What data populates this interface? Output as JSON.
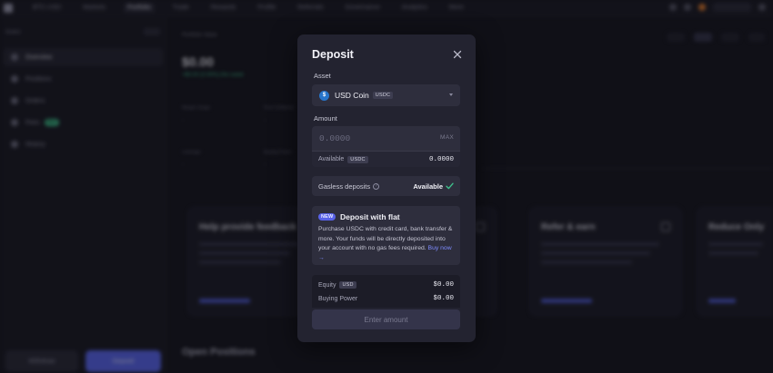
{
  "background": {
    "nav": [
      "BTC-USD",
      "Markets",
      "Portfolio",
      "Trade",
      "Rewards",
      "Profile",
      "Referrals",
      "Governance",
      "Analytics",
      "More"
    ],
    "sidebar": {
      "header": "Wallet",
      "items": [
        {
          "label": "Overview",
          "icon": "grid-icon"
        },
        {
          "label": "Positions",
          "icon": "position-icon"
        },
        {
          "label": "Orders",
          "icon": "orders-icon"
        },
        {
          "label": "Fees",
          "icon": "fees-icon",
          "badge": "New"
        },
        {
          "label": "History",
          "icon": "history-icon"
        }
      ],
      "withdraw_label": "Withdraw",
      "deposit_label": "Deposit"
    },
    "main": {
      "header": "Portfolio Value",
      "balance": "$0.00",
      "change": "+$0.00 (0.00%) this week",
      "stats": [
        "Margin Usage",
        "Free Collateral",
        "Leverage",
        "Buying Power"
      ],
      "cards": [
        {
          "title": "Help provide feedback"
        },
        {
          "title": "Refer & earn"
        },
        {
          "title": "Reduce Only"
        }
      ],
      "open_positions": "Open Positions"
    }
  },
  "modal": {
    "title": "Deposit",
    "close_icon": "close-icon",
    "asset_label": "Asset",
    "asset": {
      "name": "USD Coin",
      "ticker": "USDC",
      "icon": "usdc-coin-icon",
      "icon_letter": "$"
    },
    "amount_label": "Amount",
    "amount_placeholder": "0.0000",
    "max_label": "MAX",
    "available_label": "Available",
    "available_ticker": "USDC",
    "available_value": "0.0000",
    "gasless_label": "Gasless deposits",
    "gasless_status": "Available",
    "fiat": {
      "badge": "NEW",
      "title": "Deposit with flat",
      "text": "Purchase USDC with credit card, bank transfer & more. Your funds will be directly deposited into your account with no gas fees required.",
      "link": "Buy now →"
    },
    "summary": [
      {
        "label": "Equity",
        "tag": "USD",
        "value": "$0.00"
      },
      {
        "label": "Buying Power",
        "tag": "",
        "value": "$0.00"
      }
    ],
    "submit_label": "Enter amount"
  },
  "colors": {
    "accent": "#5862e8",
    "success": "#3fbf8c",
    "usdc": "#2775ca",
    "modal_bg": "#232330"
  }
}
